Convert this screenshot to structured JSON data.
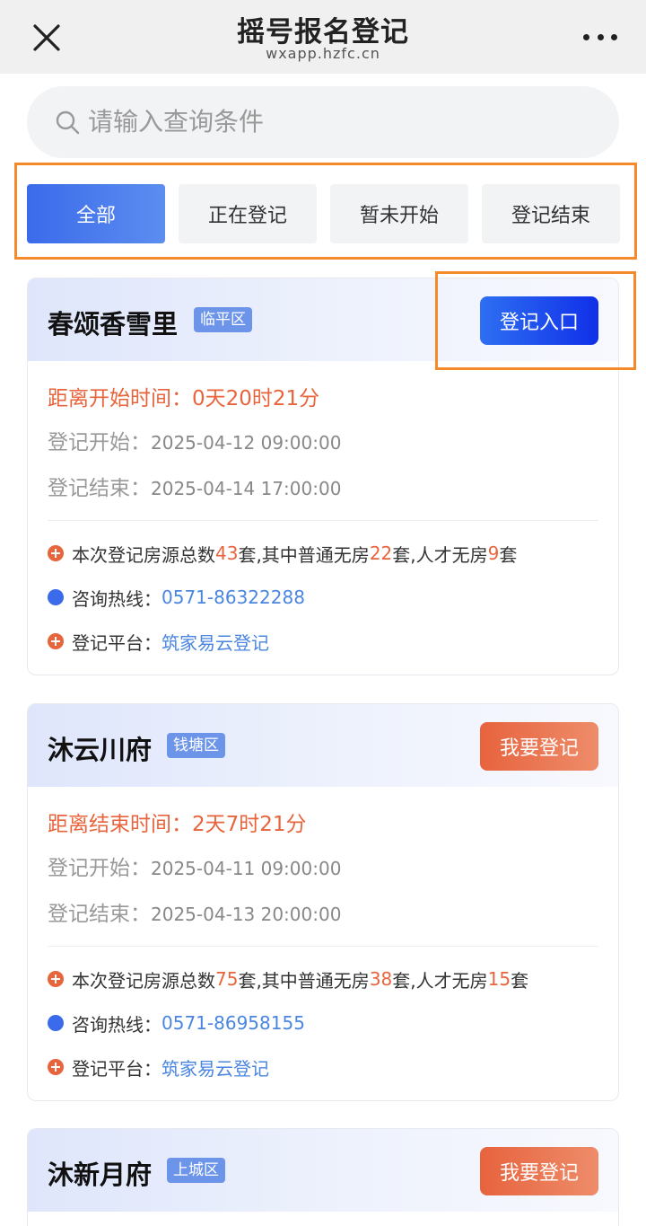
{
  "nav": {
    "title": "摇号报名登记",
    "url": "wxapp.hzfc.cn",
    "close_icon": "close-icon",
    "more_icon": "more-icon"
  },
  "search": {
    "placeholder": "请输入查询条件",
    "icon": "search-icon"
  },
  "filters": [
    {
      "label": "全部",
      "active": true
    },
    {
      "label": "正在登记",
      "active": false
    },
    {
      "label": "暂未开始",
      "active": false
    },
    {
      "label": "登记结束",
      "active": false
    }
  ],
  "labels": {
    "reg_start": "登记开始：",
    "reg_end": "登记结束：",
    "source_prefix": "本次登记房源总数",
    "set": "套",
    "normal": ",其中普通无房",
    "talent": ",人才无房",
    "hotline": "咨询热线：",
    "platform": "登记平台："
  },
  "colors": {
    "accent_blue": "#3b6bea",
    "accent_orange": "#e8643d",
    "highlight_frame": "#f58a2a"
  },
  "projects": [
    {
      "name": "春颂香雪里",
      "district": "临平区",
      "action": "登记入口",
      "action_style": "blue",
      "countdown": "距离开始时间：0天20时21分",
      "start": "2025-04-12 09:00:00",
      "end": "2025-04-14 17:00:00",
      "total": "43",
      "normal": "22",
      "talent": "9",
      "hotline": "0571-86322288",
      "platform": "筑家易云登记"
    },
    {
      "name": "沐云川府",
      "district": "钱塘区",
      "action": "我要登记",
      "action_style": "orange",
      "countdown": "距离结束时间：2天7时21分",
      "start": "2025-04-11 09:00:00",
      "end": "2025-04-13 20:00:00",
      "total": "75",
      "normal": "38",
      "talent": "15",
      "hotline": "0571-86958155",
      "platform": "筑家易云登记"
    },
    {
      "name": "沐新月府",
      "district": "上城区",
      "action": "我要登记",
      "action_style": "orange"
    }
  ]
}
